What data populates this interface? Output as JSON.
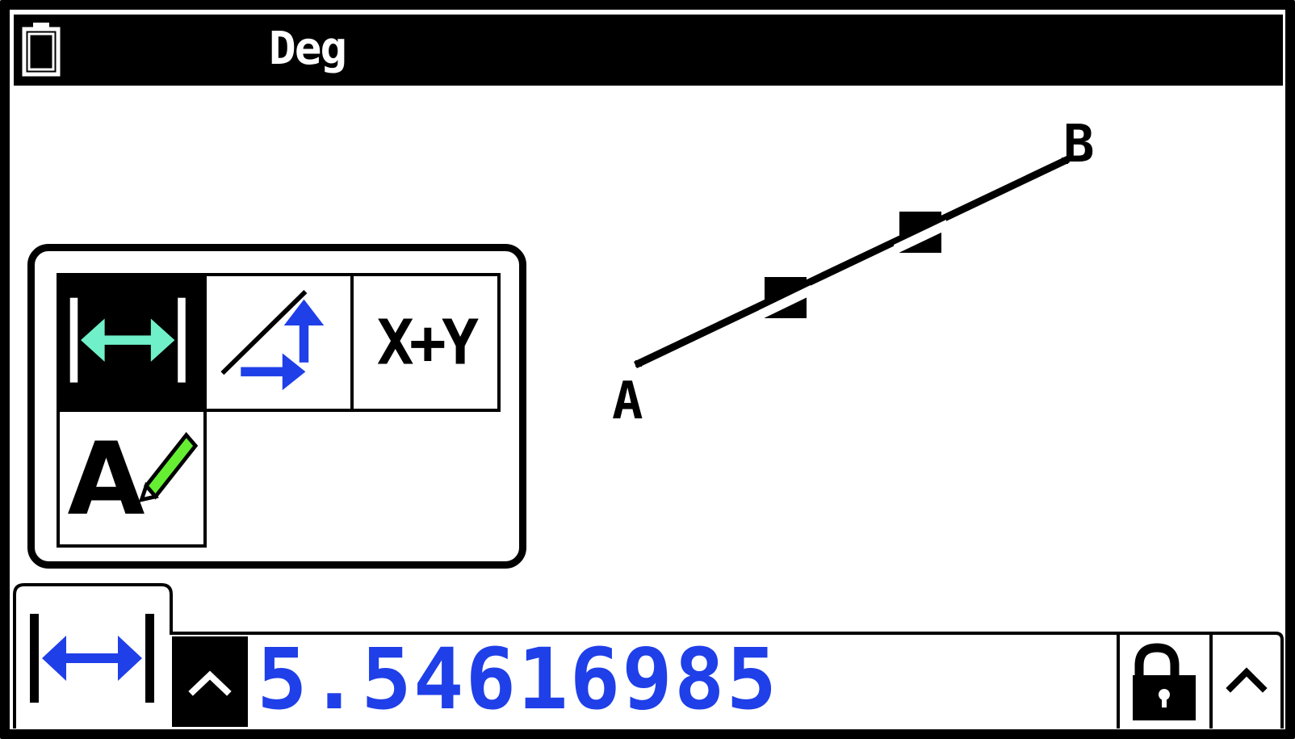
{
  "status_bar": {
    "angle_mode": "Deg",
    "battery_icon": "battery-icon"
  },
  "geometry": {
    "points": [
      {
        "label": "A"
      },
      {
        "label": "B"
      }
    ],
    "segment": {
      "endpoints": [
        "A",
        "B"
      ],
      "selected": true
    }
  },
  "measure_palette": {
    "items": [
      {
        "id": "length",
        "icon": "length-icon",
        "selected": true
      },
      {
        "id": "slope",
        "icon": "slope-icon",
        "selected": false
      },
      {
        "id": "sum",
        "icon": "sum-icon",
        "label": "X+Y",
        "selected": false
      },
      {
        "id": "label",
        "icon": "label-icon",
        "label": "A",
        "selected": false
      }
    ]
  },
  "measurement_bar": {
    "mode_icon": "length-icon",
    "value": "5.54616985",
    "lock_icon": "unlocked-icon",
    "expand_icons": [
      "chevron-up-icon",
      "chevron-up-icon"
    ]
  },
  "colors": {
    "value_text": "#1f3fe8",
    "length_arrow": "#70f0c8",
    "slope_arrows": "#1f3fe8",
    "pencil_fill": "#66ee33",
    "foreground": "#000000",
    "background": "#ffffff"
  }
}
